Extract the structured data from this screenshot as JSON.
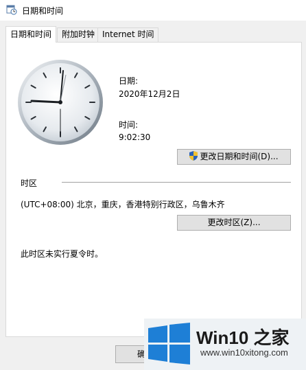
{
  "window": {
    "title": "日期和时间",
    "icon": "calendar-clock-icon"
  },
  "tabs": [
    {
      "label": "日期和时间",
      "active": true
    },
    {
      "label": "附加时钟",
      "active": false
    },
    {
      "label": "Internet 时间",
      "active": false
    }
  ],
  "datetime": {
    "date_label": "日期:",
    "date_value": "2020年12月2日",
    "time_label": "时间:",
    "time_value": "9:02:30",
    "change_button": "更改日期和时间(D)..."
  },
  "timezone": {
    "section_label": "时区",
    "value": "(UTC+08:00) 北京，重庆，香港特别行政区，乌鲁木齐",
    "change_button": "更改时区(Z)...",
    "dst_note": "此时区未实行夏令时。"
  },
  "footer": {
    "ok_button": "确"
  },
  "watermark": {
    "brand": "Win10 之家",
    "url": "www.win10xitong.com",
    "logo_color": "#1e7fd6"
  }
}
